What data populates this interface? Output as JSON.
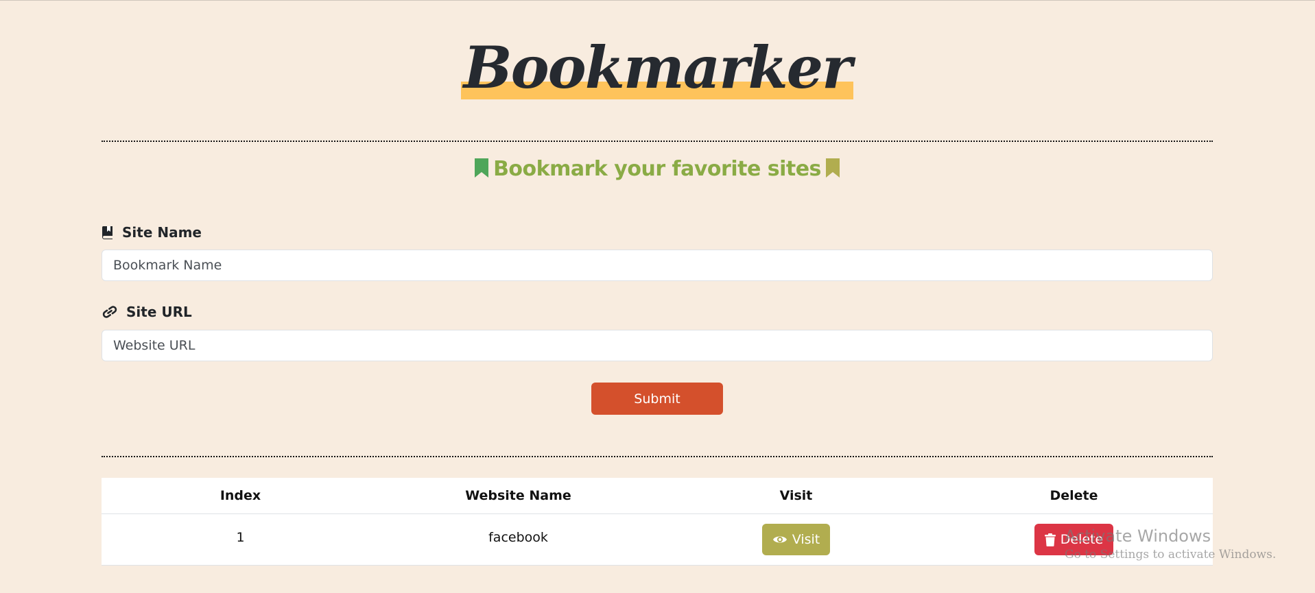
{
  "header": {
    "logo_text": "Bookmarker",
    "subtitle": "Bookmark your favorite sites",
    "colors": {
      "logo_highlight": "#fec35b",
      "subtitle": "#8aab45",
      "bookmark_left": "#4fa65a",
      "bookmark_right": "#b1ad4f"
    }
  },
  "form": {
    "name_label": "Site Name",
    "name_icon": "book-bookmark-icon",
    "name_placeholder": "Bookmark Name",
    "url_label": "Site URL",
    "url_icon": "link-icon",
    "url_placeholder": "Website URL",
    "submit_label": "Submit",
    "submit_color": "#d4502c"
  },
  "table": {
    "columns": [
      "Index",
      "Website Name",
      "Visit",
      "Delete"
    ],
    "rows": [
      {
        "index": "1",
        "name": "facebook",
        "visit_label": "Visit",
        "visit_icon": "eye-icon",
        "delete_label": "Delete",
        "delete_icon": "trash-icon"
      }
    ]
  },
  "watermark": {
    "title": "Activate Windows",
    "subtitle": "Go to Settings to activate Windows."
  }
}
